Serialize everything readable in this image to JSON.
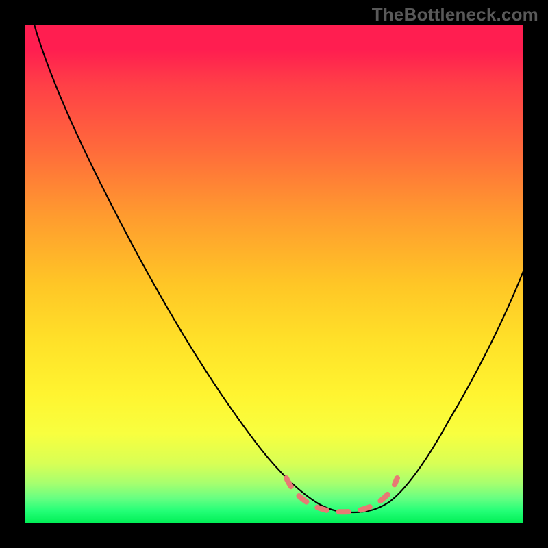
{
  "watermark": "TheBottleneck.com",
  "colors": {
    "frame": "#000000",
    "watermark_text": "#595959",
    "curve": "#000000",
    "dashed": "#e77a74",
    "grad_top": "#ff1e50",
    "grad_bottom": "#00ef55"
  },
  "chart_data": {
    "type": "line",
    "title": "",
    "xlabel": "",
    "ylabel": "",
    "xlim": [
      0,
      100
    ],
    "ylim": [
      0,
      100
    ],
    "grid": false,
    "legend": false,
    "annotations": [
      "TheBottleneck.com"
    ],
    "series": [
      {
        "name": "curve-left",
        "x": [
          2,
          10,
          20,
          30,
          40,
          50,
          56,
          60
        ],
        "y": [
          100,
          85,
          67,
          49,
          32,
          15,
          6,
          2
        ]
      },
      {
        "name": "curve-right",
        "x": [
          70,
          76,
          82,
          88,
          94,
          100
        ],
        "y": [
          2,
          8,
          18,
          30,
          42,
          53
        ]
      },
      {
        "name": "dashed-bottom",
        "x": [
          52,
          55,
          60,
          65,
          70,
          73
        ],
        "y": [
          10,
          4,
          1,
          1,
          4,
          10
        ]
      }
    ]
  }
}
